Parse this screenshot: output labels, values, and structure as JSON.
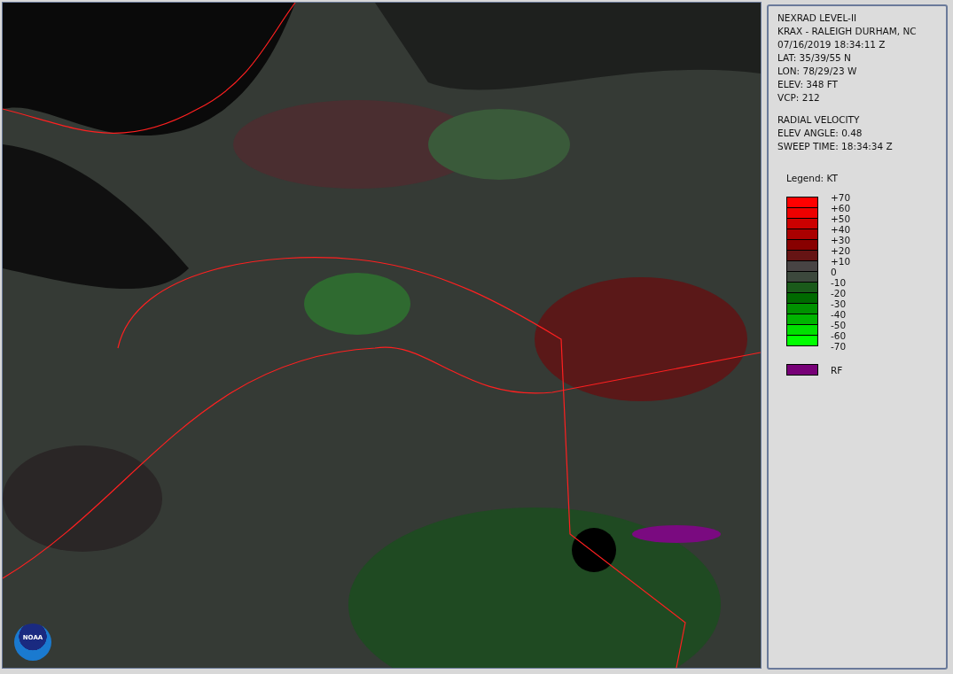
{
  "map": {
    "kind": "picture",
    "logo_text": "NOAA"
  },
  "info": {
    "lines": [
      "NEXRAD LEVEL-II",
      "KRAX - RALEIGH DURHAM, NC",
      "07/16/2019 18:34:11 Z",
      "LAT: 35/39/55 N",
      "LON: 78/29/23 W",
      "ELEV: 348 FT",
      "VCP: 212"
    ],
    "product_lines": [
      "RADIAL VELOCITY",
      "ELEV ANGLE: 0.48",
      "SWEEP TIME: 18:34:34 Z"
    ]
  },
  "legend": {
    "title": "Legend: KT",
    "swatches": [
      {
        "color": "#ff0000"
      },
      {
        "color": "#ee0000"
      },
      {
        "color": "#cc0000"
      },
      {
        "color": "#aa0000"
      },
      {
        "color": "#880000"
      },
      {
        "color": "#661414"
      },
      {
        "color": "#484444"
      },
      {
        "color": "#3c483c"
      },
      {
        "color": "#1a5a1a"
      },
      {
        "color": "#006a00"
      },
      {
        "color": "#009200"
      },
      {
        "color": "#00b400"
      },
      {
        "color": "#00e000"
      },
      {
        "color": "#00ff00"
      }
    ],
    "labels": [
      "+70",
      "+60",
      "+50",
      "+40",
      "+30",
      "+20",
      "+10",
      "0",
      "-10",
      "-20",
      "-30",
      "-40",
      "-50",
      "-60",
      "-70"
    ],
    "extra": [
      {
        "color": "#770077",
        "label": "RF"
      }
    ]
  }
}
